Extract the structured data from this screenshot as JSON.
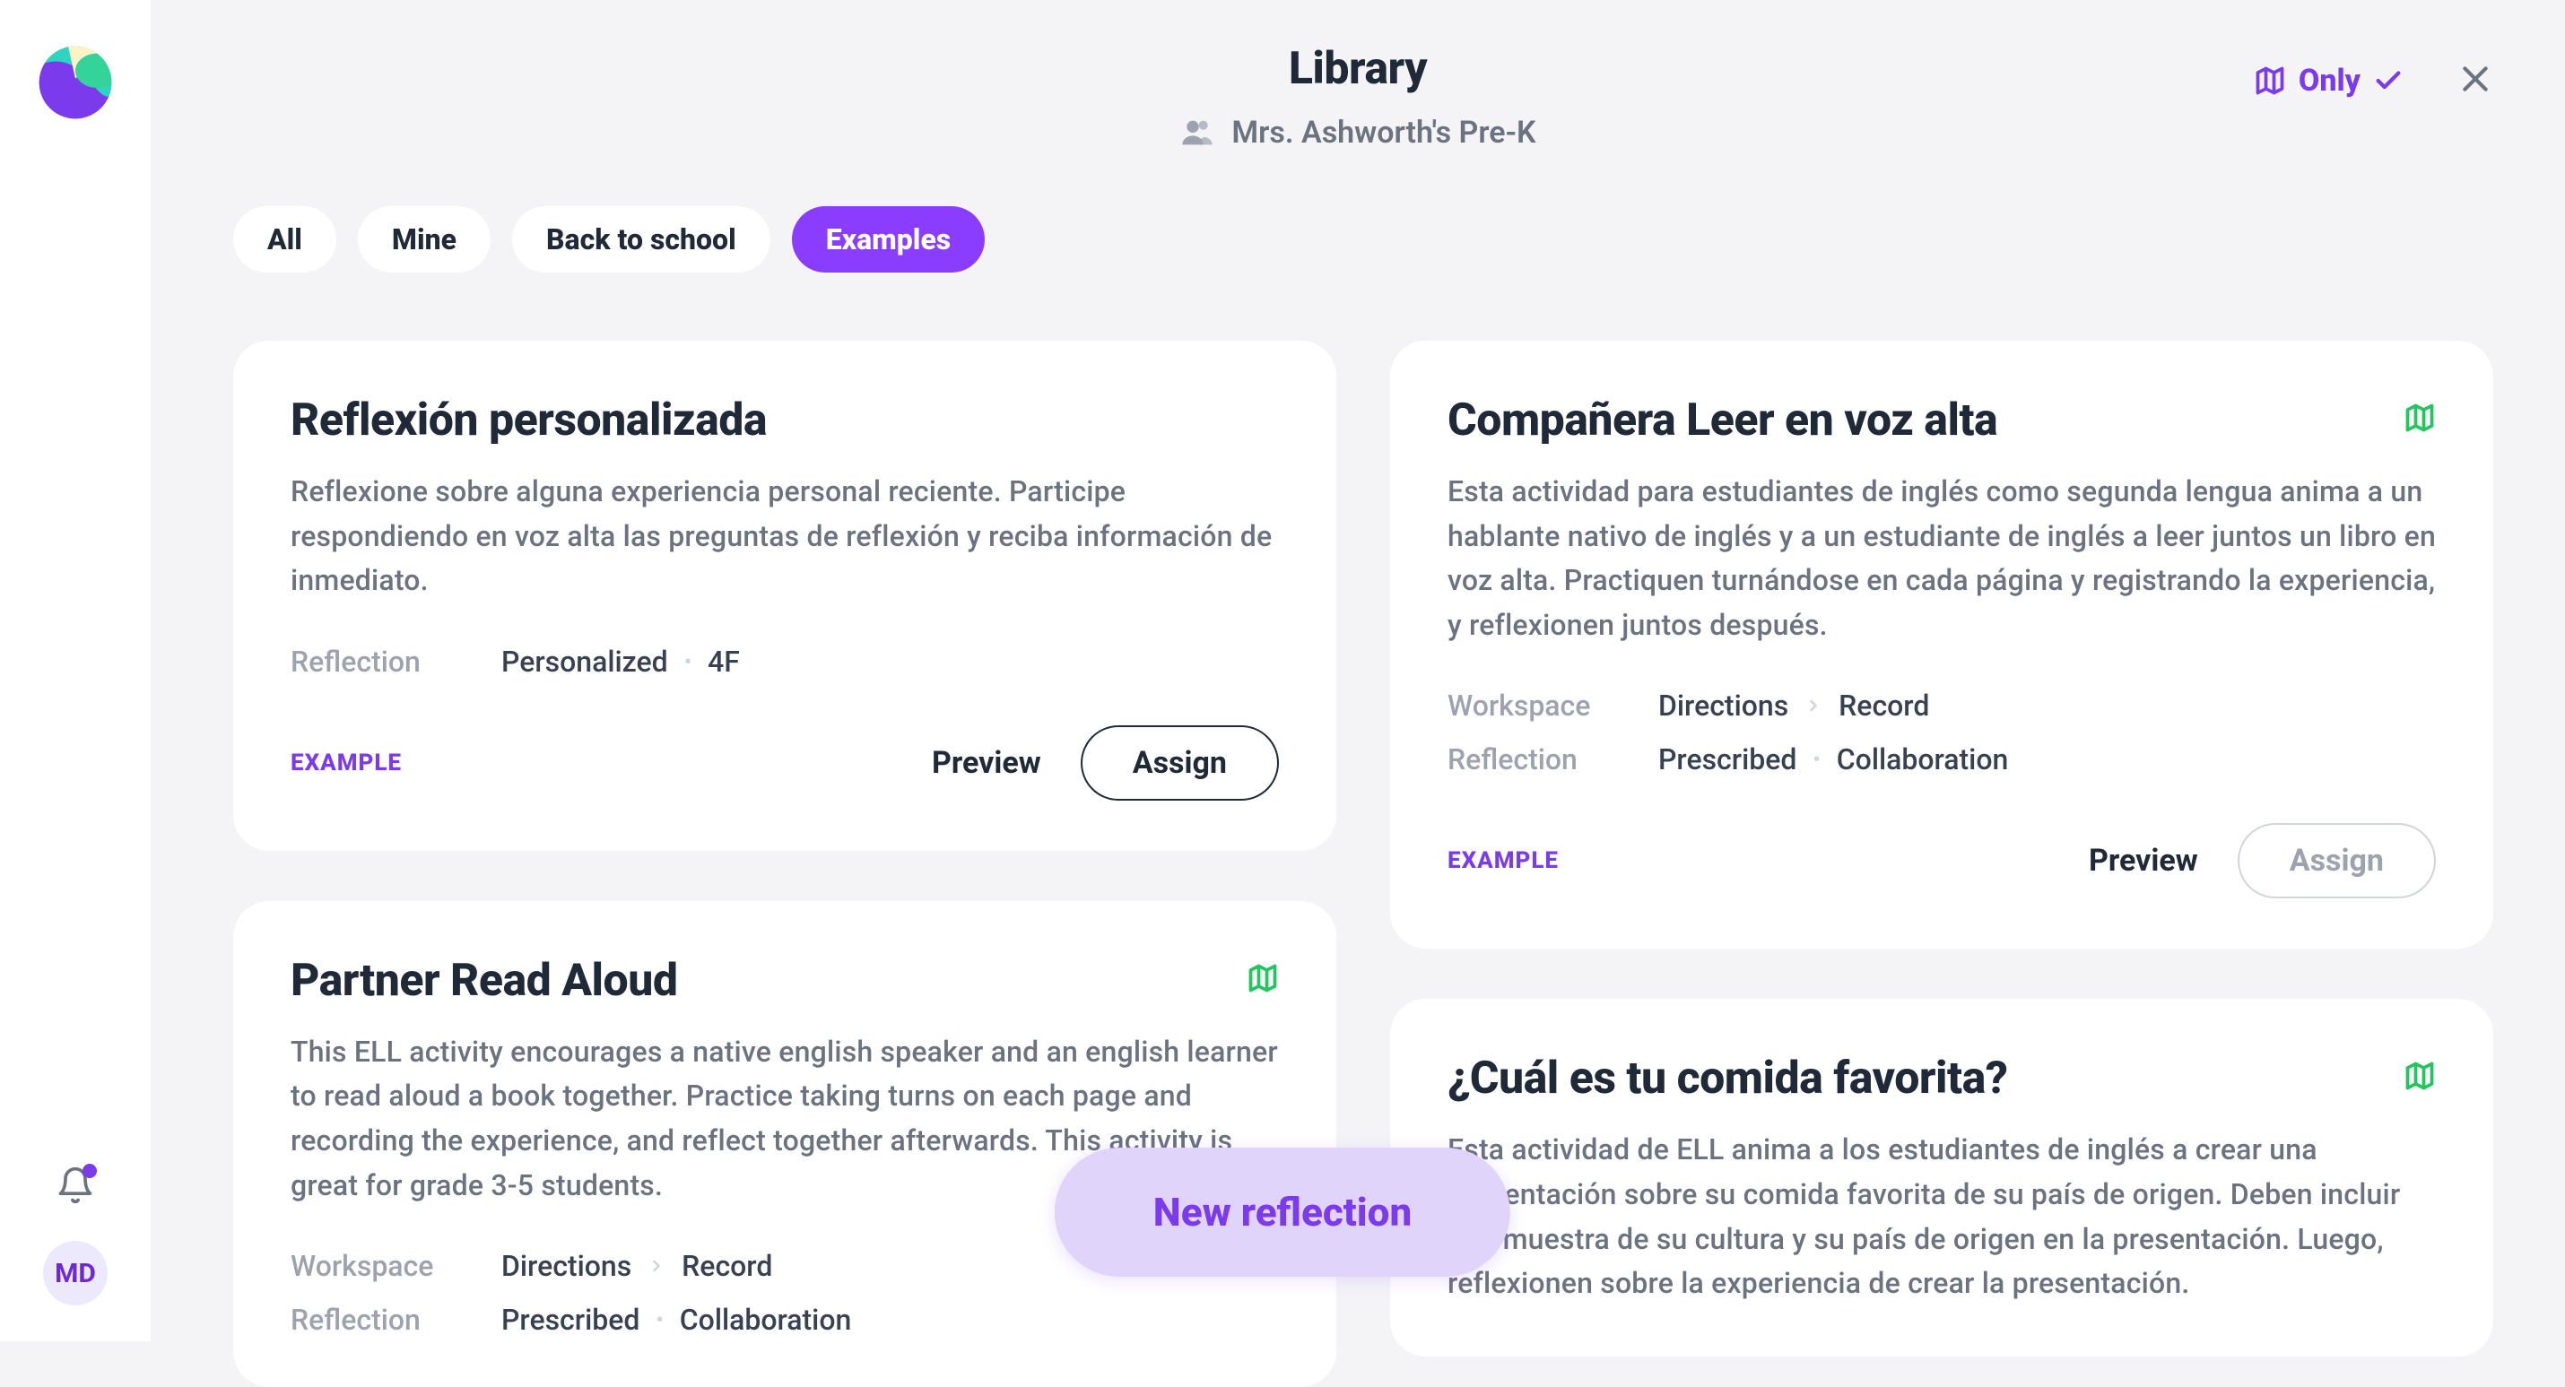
{
  "sidebar": {
    "avatar_initials": "MD"
  },
  "header": {
    "title": "Library",
    "subtitle": "Mrs. Ashworth's Pre-K",
    "only_label": "Only"
  },
  "filters": {
    "items": [
      {
        "label": "All"
      },
      {
        "label": "Mine"
      },
      {
        "label": "Back to school"
      },
      {
        "label": "Examples"
      }
    ]
  },
  "col_left": {
    "card_1": {
      "title": "Reflexión personalizada",
      "description": "Reflexione sobre alguna experiencia personal reciente. Participe respondiendo en voz alta las preguntas de reflexión y reciba información de inmediato.",
      "reflection_label": "Reflection",
      "reflection_v1": "Personalized",
      "reflection_v2": "4F",
      "example_tag": "EXAMPLE",
      "preview": "Preview",
      "assign": "Assign"
    },
    "card_2": {
      "title": "Partner Read Aloud",
      "description": "This ELL activity encourages a native english speaker and an english learner to read aloud a book together. Practice taking turns on each page and recording the experience, and reflect together afterwards. This activity is great for grade 3-5 students.",
      "workspace_label": "Workspace",
      "ws_v1": "Directions",
      "ws_v2": "Record",
      "reflection_label": "Reflection",
      "reflection_v1": "Prescribed",
      "reflection_v2": "Collaboration"
    }
  },
  "col_right": {
    "card_1": {
      "title": "Compañera Leer en voz alta",
      "description": "Esta actividad para estudiantes de inglés como segunda lengua anima a un hablante nativo de inglés y a un estudiante de inglés a leer juntos un libro en voz alta. Practiquen turnándose en cada página y registrando la experiencia, y reflexionen juntos después.",
      "workspace_label": "Workspace",
      "ws_v1": "Directions",
      "ws_v2": "Record",
      "reflection_label": "Reflection",
      "reflection_v1": "Prescribed",
      "reflection_v2": "Collaboration",
      "example_tag": "EXAMPLE",
      "preview": "Preview",
      "assign": "Assign"
    },
    "card_2": {
      "title": "¿Cuál es tu comida favorita?",
      "description": "Esta actividad de ELL anima a los estudiantes de inglés a crear una presentación sobre su comida favorita de su país de origen. Deben incluir una muestra de su cultura y su país de origen en la presentación. Luego, reflexionen sobre la experiencia de crear la presentación."
    }
  },
  "fab": {
    "label": "New reflection"
  },
  "colors": {
    "primary": "#7c3aed",
    "green": "#22c55e"
  }
}
